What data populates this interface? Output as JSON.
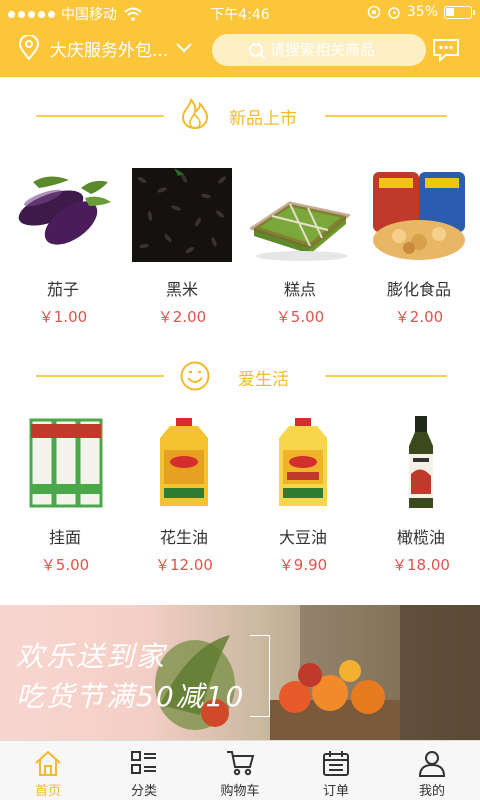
{
  "status_bar": {
    "carrier": "中国移动",
    "time": "下午4:46",
    "battery": "35%",
    "battery_level": 0.35
  },
  "nav": {
    "location": "大庆服务外包...",
    "search_placeholder": "请搜索相关商品",
    "icons": [
      "location-pin-icon",
      "chevron-down-icon",
      "search-icon",
      "message-icon"
    ]
  },
  "sections": [
    {
      "title": "新品上市",
      "icon": "flame-icon",
      "products": [
        {
          "name": "茄子",
          "price": "￥1.00"
        },
        {
          "name": "黑米",
          "price": "￥2.00"
        },
        {
          "name": "糕点",
          "price": "￥5.00"
        },
        {
          "name": "膨化食品",
          "price": "￥2.00"
        }
      ]
    },
    {
      "title": "爱生活",
      "icon": "smile-icon",
      "products": [
        {
          "name": "挂面",
          "price": "￥5.00"
        },
        {
          "name": "花生油",
          "price": "￥12.00"
        },
        {
          "name": "大豆油",
          "price": "￥9.90"
        },
        {
          "name": "橄榄油",
          "price": "￥18.00"
        }
      ]
    }
  ],
  "banner": {
    "line1": "欢乐送到家",
    "line2": "吃货节满50减10"
  },
  "tabbar": [
    {
      "label": "首页",
      "icon": "home-icon",
      "active": true
    },
    {
      "label": "分类",
      "icon": "category-icon",
      "active": false
    },
    {
      "label": "购物车",
      "icon": "cart-icon",
      "active": false
    },
    {
      "label": "订单",
      "icon": "order-icon",
      "active": false
    },
    {
      "label": "我的",
      "icon": "user-icon",
      "active": false
    }
  ],
  "colors": {
    "accent": "#fbc639",
    "title": "#f5b92e",
    "price": "#e2534b"
  }
}
